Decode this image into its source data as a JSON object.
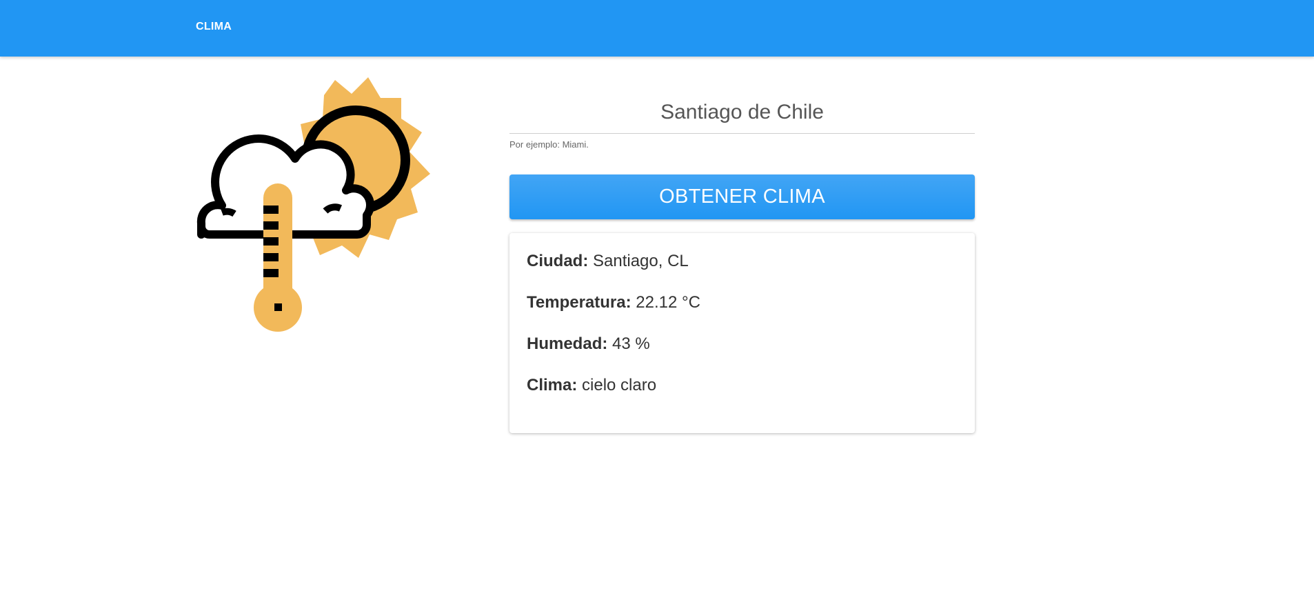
{
  "navbar": {
    "brand": "CLIMA"
  },
  "illustration": {
    "icon": "weather-cloud-sun-thermometer-icon",
    "sun_color": "#f2b95a",
    "outline_color": "#000000"
  },
  "search": {
    "value": "Santiago de Chile",
    "helper": "Por ejemplo: Miami."
  },
  "action": {
    "button_label": "OBTENER CLIMA"
  },
  "result": {
    "city_label": "Ciudad:",
    "city_value": "Santiago, CL",
    "temp_label": "Temperatura:",
    "temp_value": "22.12 °C",
    "humidity_label": "Humedad:",
    "humidity_value": "43 %",
    "weather_label": "Clima:",
    "weather_value": "cielo claro"
  },
  "colors": {
    "primary": "#2196f3",
    "text": "#333333"
  }
}
